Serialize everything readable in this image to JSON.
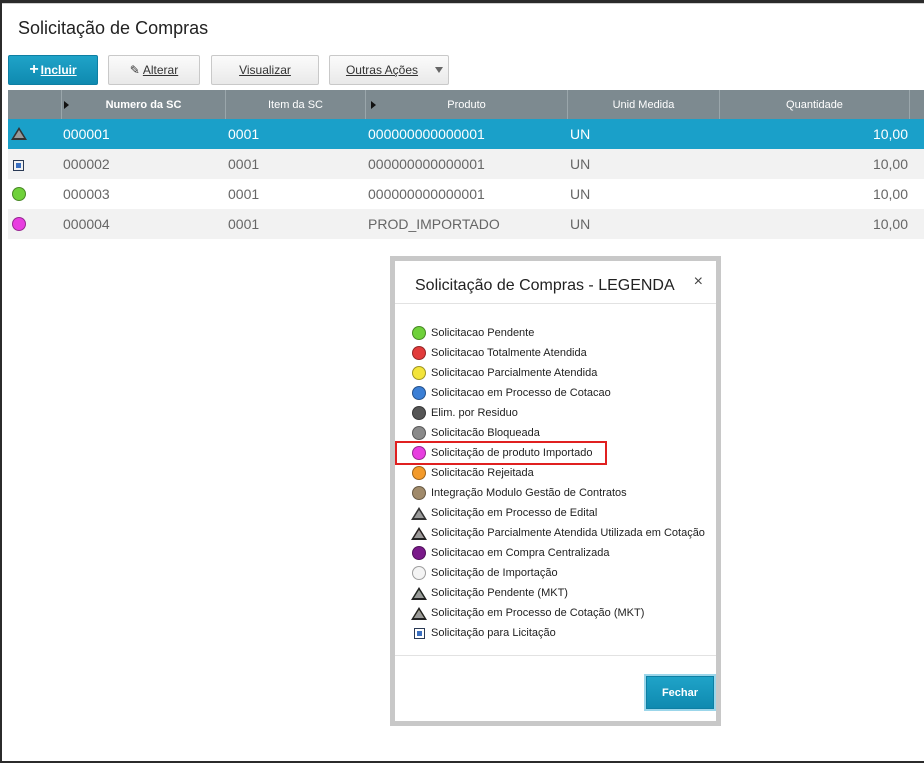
{
  "page": {
    "title": "Solicitação de Compras"
  },
  "toolbar": {
    "incluir": "Incluir",
    "alterar": "Alterar",
    "visualizar": "Visualizar",
    "outras_acoes": "Outras Ações"
  },
  "grid": {
    "headers": [
      "Numero da SC",
      "Item da SC",
      "Produto",
      "Unid Medida",
      "Quantidade"
    ],
    "rows": [
      {
        "status": "triangle-gray",
        "numero": "000001",
        "item": "0001",
        "produto": "000000000000001",
        "unid": "UN",
        "qtd": "10,00"
      },
      {
        "status": "square-blue",
        "numero": "000002",
        "item": "0001",
        "produto": "000000000000001",
        "unid": "UN",
        "qtd": "10,00"
      },
      {
        "status": "circle-green",
        "numero": "000003",
        "item": "0001",
        "produto": "000000000000001",
        "unid": "UN",
        "qtd": "10,00"
      },
      {
        "status": "circle-magenta",
        "numero": "000004",
        "item": "0001",
        "produto": "PROD_IMPORTADO",
        "unid": "UN",
        "qtd": "10,00"
      }
    ]
  },
  "dialog": {
    "title": "Solicitação de Compras - LEGENDA",
    "close": "×",
    "button": "Fechar",
    "items": [
      {
        "label": "Solicitacao Pendente",
        "icon": "circle",
        "color": "#6fd13a"
      },
      {
        "label": "Solicitacao Totalmente Atendida",
        "icon": "circle",
        "color": "#e23b3b"
      },
      {
        "label": "Solicitacao Parcialmente Atendida",
        "icon": "circle",
        "color": "#f3e43a"
      },
      {
        "label": "Solicitacao em Processo de Cotacao",
        "icon": "circle",
        "color": "#3b7fd6"
      },
      {
        "label": "Elim. por Residuo",
        "icon": "circle",
        "color": "#555555"
      },
      {
        "label": "Solicitacão Bloqueada",
        "icon": "circle",
        "color": "#8a8a8a"
      },
      {
        "label": "Solicitação de produto Importado",
        "icon": "circle",
        "color": "#e83ee0"
      },
      {
        "label": "Solicitacão Rejeitada",
        "icon": "circle",
        "color": "#f39a2a"
      },
      {
        "label": "Integração Modulo Gestão de Contratos",
        "icon": "circle",
        "color": "#a08a6a"
      },
      {
        "label": "Solicitação em Processo de Edital",
        "icon": "triangle",
        "color": "#9a9a9a"
      },
      {
        "label": "Solicitação Parcialmente Atendida Utilizada em Cotação",
        "icon": "triangle",
        "color": "#e23b3b"
      },
      {
        "label": "Solicitacao em Compra Centralizada",
        "icon": "circle",
        "color": "#7a1a8a"
      },
      {
        "label": "Solicitação de Importação",
        "icon": "circle",
        "color": "#f4f4f4"
      },
      {
        "label": "Solicitação Pendente (MKT)",
        "icon": "triangle",
        "color": "#3ac33a"
      },
      {
        "label": "Solicitação em Processo de Cotação (MKT)",
        "icon": "triangle",
        "color": "#f3e43a"
      },
      {
        "label": "Solicitação para Licitação",
        "icon": "square",
        "color": "#3a6fc0"
      }
    ]
  },
  "colors": {
    "accent": "#1aa0c9",
    "header": "#7d8a90",
    "highlight": "#e02020"
  }
}
